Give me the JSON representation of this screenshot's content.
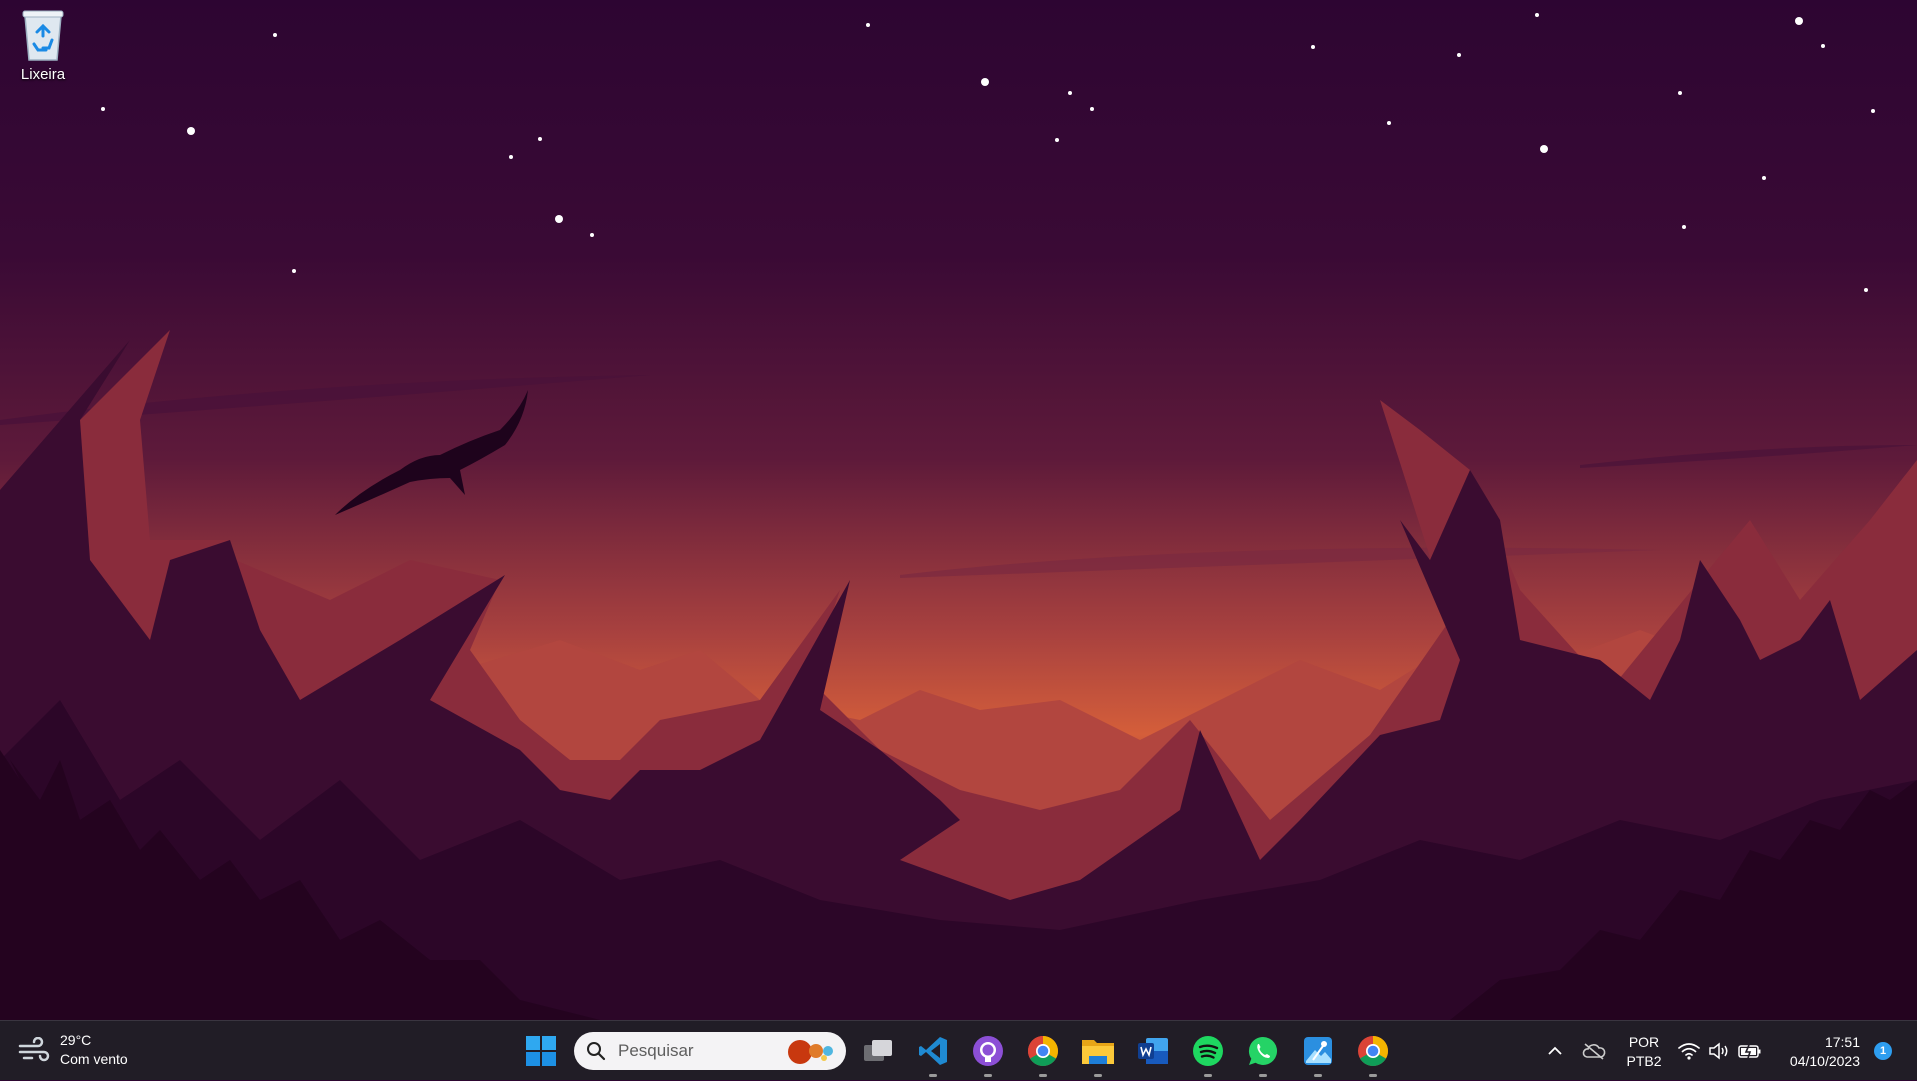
{
  "desktop": {
    "icons": [
      {
        "label": "Lixeira",
        "icon": "recycle-bin-icon"
      }
    ]
  },
  "taskbar": {
    "weather": {
      "temperature": "29°C",
      "condition": "Com vento",
      "icon": "wind-icon"
    },
    "search": {
      "placeholder": "Pesquisar"
    },
    "apps": [
      {
        "name": "start",
        "icon": "windows-start-icon"
      },
      {
        "name": "task-view",
        "icon": "task-view-icon"
      },
      {
        "name": "vscode",
        "icon": "vscode-icon"
      },
      {
        "name": "github-desktop",
        "icon": "github-icon"
      },
      {
        "name": "chrome",
        "icon": "chrome-icon"
      },
      {
        "name": "file-explorer",
        "icon": "folder-icon"
      },
      {
        "name": "word",
        "icon": "word-icon"
      },
      {
        "name": "spotify",
        "icon": "spotify-icon"
      },
      {
        "name": "whatsapp",
        "icon": "whatsapp-icon"
      },
      {
        "name": "photos",
        "icon": "photos-icon"
      },
      {
        "name": "chrome-2",
        "icon": "chrome-icon"
      }
    ],
    "tray": {
      "language_line1": "POR",
      "language_line2": "PTB2",
      "time": "17:51",
      "date": "04/10/2023",
      "notification_count": "1"
    }
  },
  "colors": {
    "taskbar_bg": "#211d26",
    "sky_top": "#2d0630",
    "glow": "#d9603a",
    "accent": "#2e9ef0"
  }
}
